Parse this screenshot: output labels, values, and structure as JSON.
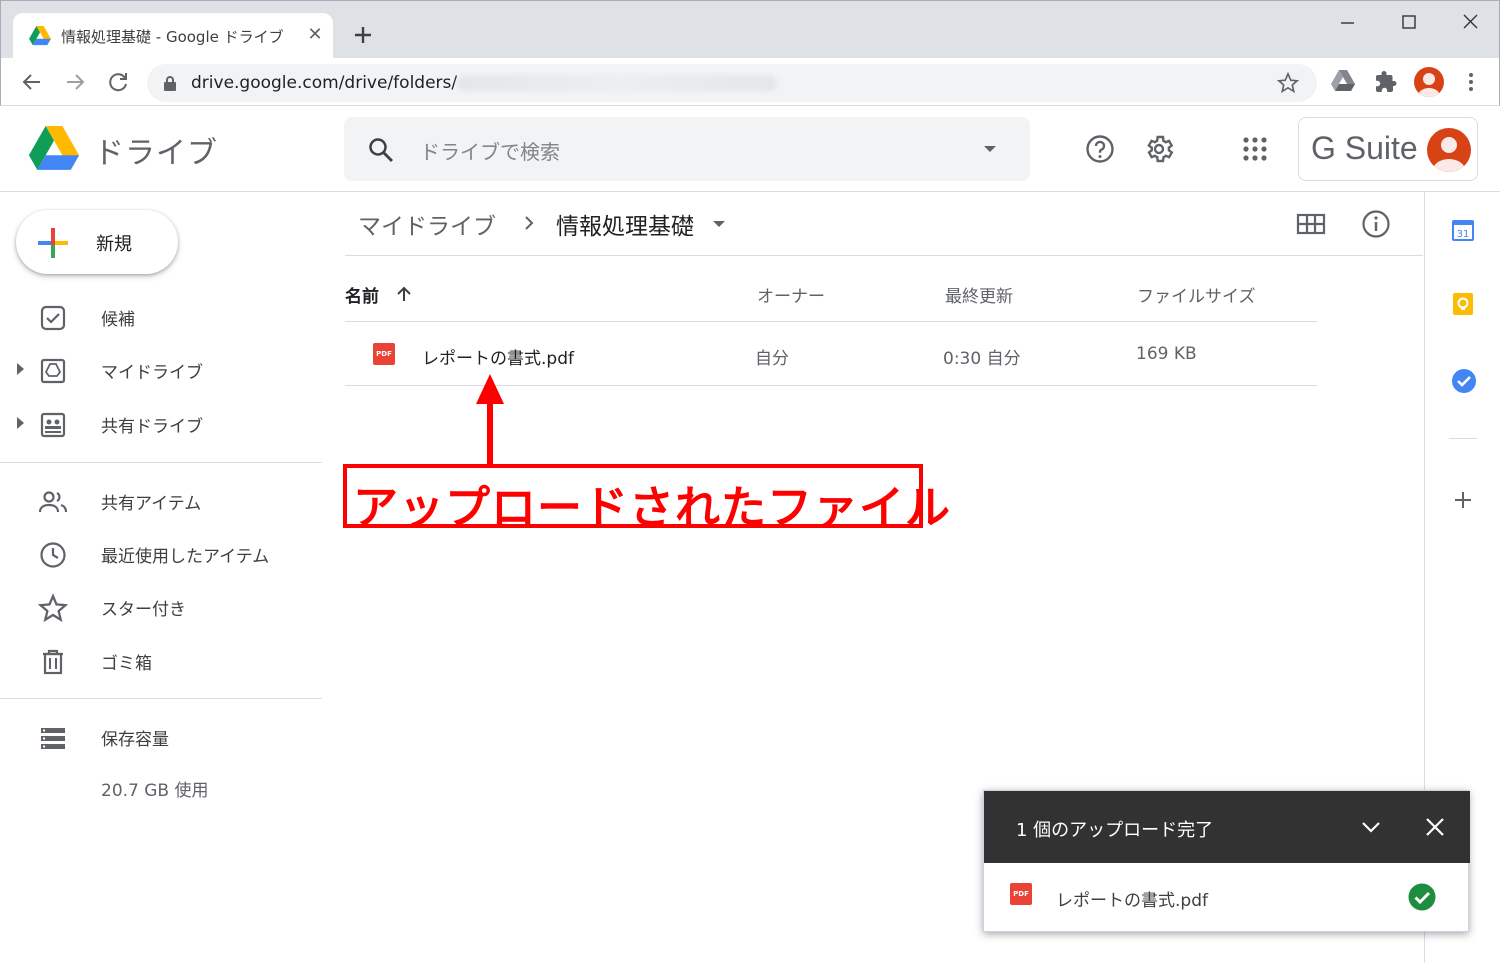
{
  "browser": {
    "tab_title": "情報処理基礎 - Google ドライブ",
    "tab_close": "✕",
    "url": "drive.google.com/drive/folders/"
  },
  "drive": {
    "logo_text": "ドライブ",
    "search_placeholder": "ドライブで検索",
    "gsuite_label": "G Suite"
  },
  "sidebar": {
    "new_button": "新規",
    "items": [
      {
        "label": "候補",
        "icon": "suggested-icon"
      },
      {
        "label": "マイドライブ",
        "icon": "my-drive-icon"
      },
      {
        "label": "共有ドライブ",
        "icon": "shared-drives-icon"
      },
      {
        "label": "共有アイテム",
        "icon": "shared-with-me-icon"
      },
      {
        "label": "最近使用したアイテム",
        "icon": "recent-icon"
      },
      {
        "label": "スター付き",
        "icon": "star-icon"
      },
      {
        "label": "ゴミ箱",
        "icon": "trash-icon"
      },
      {
        "label": "保存容量",
        "icon": "storage-icon"
      }
    ],
    "storage_used": "20.7 GB 使用"
  },
  "main": {
    "breadcrumb_root": "マイドライブ",
    "breadcrumb_current": "情報処理基礎",
    "columns": {
      "name": "名前",
      "owner": "オーナー",
      "modified": "最終更新",
      "size": "ファイルサイズ"
    },
    "files": [
      {
        "name": "レポートの書式.pdf",
        "owner": "自分",
        "modified": "0:30 自分",
        "size": "169 KB",
        "type_badge": "PDF"
      }
    ]
  },
  "annotation": {
    "label": "アップロードされたファイル",
    "color": "#ff0000"
  },
  "upload_toast": {
    "title": "1 個のアップロード完了",
    "file_name": "レポートの書式.pdf"
  },
  "colors": {
    "pdf_red": "#ea4335",
    "success_green": "#1e8e3e",
    "toast_header": "#323232"
  }
}
